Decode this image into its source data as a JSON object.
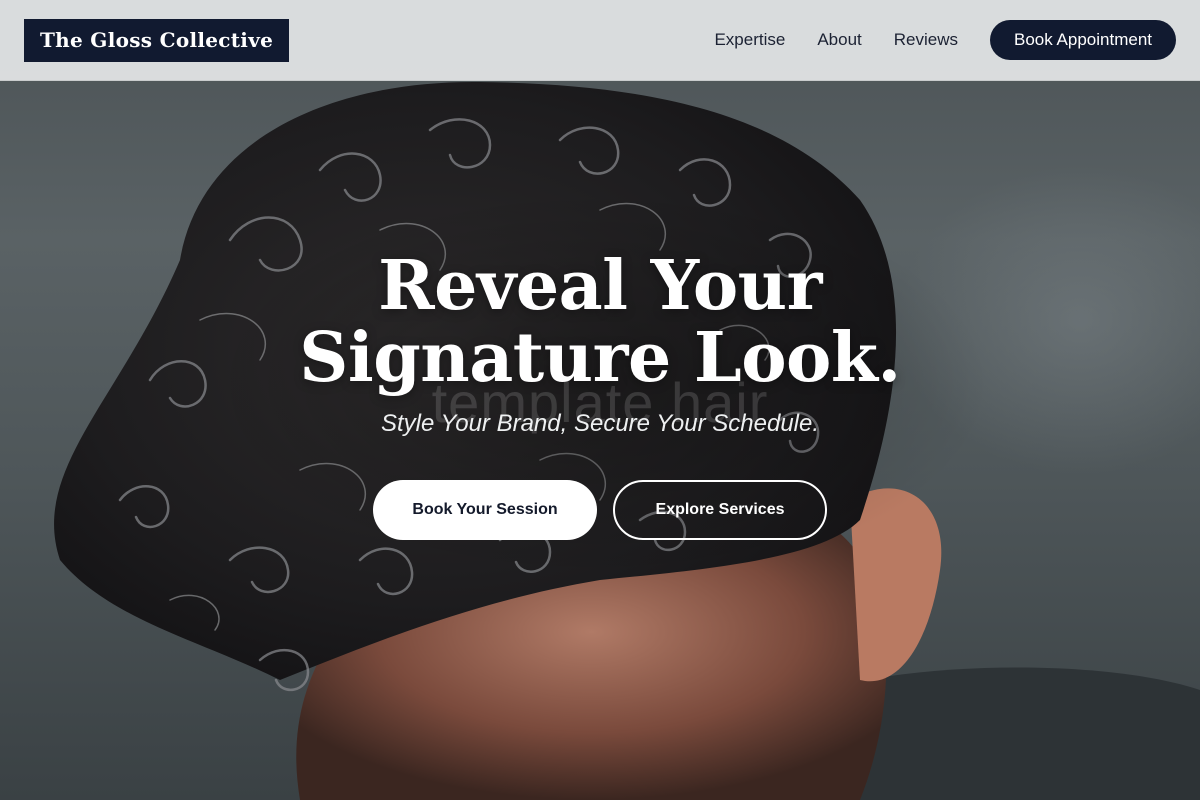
{
  "header": {
    "logo_text": "The Gloss Collective",
    "nav": [
      {
        "label": "Expertise"
      },
      {
        "label": "About"
      },
      {
        "label": "Reviews"
      }
    ],
    "cta_label": "Book Appointment"
  },
  "hero": {
    "headline": "Reveal Your Signature Look.",
    "watermark": "template hair",
    "tagline": "Style Your Brand, Secure Your Schedule.",
    "primary_cta": "Book Your Session",
    "secondary_cta": "Explore Services",
    "image_subject": "close-up of curly dark hair"
  },
  "colors": {
    "brand_navy": "#111a30",
    "header_bg": "#e2e4e5",
    "hero_text": "#ffffff"
  }
}
